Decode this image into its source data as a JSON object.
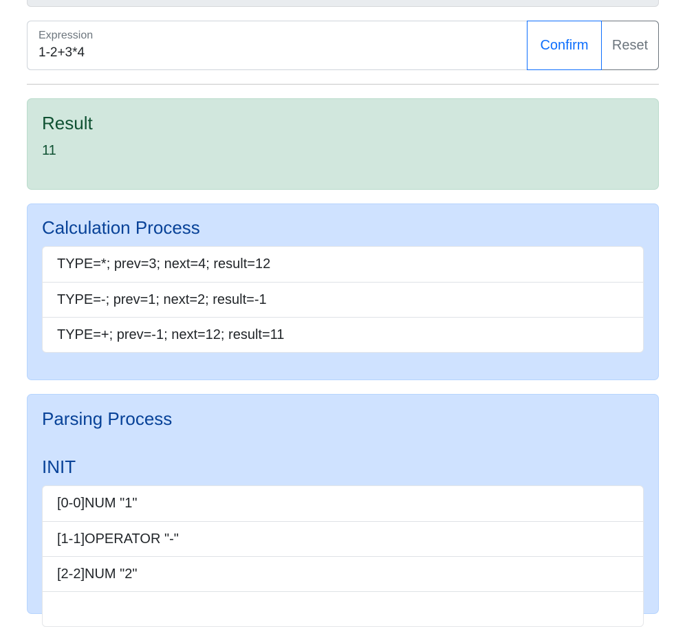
{
  "expression": {
    "label": "Expression",
    "value": "1-2+3*4",
    "confirm_label": "Confirm",
    "reset_label": "Reset"
  },
  "result": {
    "heading": "Result",
    "value": "11"
  },
  "calculation": {
    "heading": "Calculation Process",
    "steps": [
      "TYPE=*; prev=3; next=4; result=12",
      "TYPE=-; prev=1; next=2; result=-1",
      "TYPE=+; prev=-1; next=12; result=11"
    ]
  },
  "parsing": {
    "heading": "Parsing Process",
    "init_heading": "INIT",
    "tokens": [
      "[0-0]NUM \"1\"",
      "[1-1]OPERATOR \"-\"",
      "[2-2]NUM \"2\"",
      ""
    ]
  },
  "colors": {
    "primary": "#0d6efd",
    "secondary": "#6c757d",
    "success_bg": "#d1e7dd",
    "success_text": "#0f5132",
    "info_bg": "#cfe2ff",
    "info_text": "#084298"
  }
}
